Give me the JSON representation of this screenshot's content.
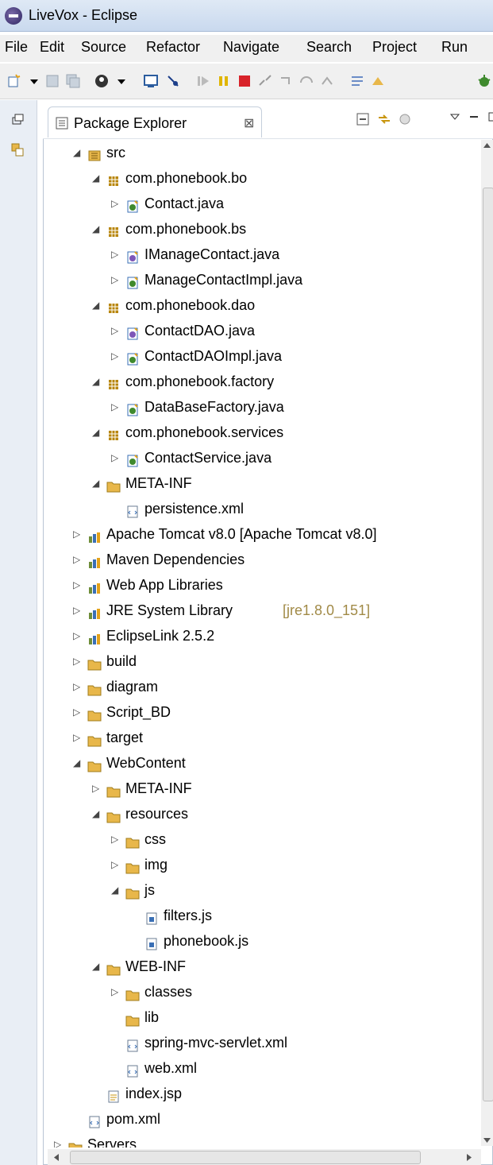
{
  "window": {
    "title": "LiveVox - Eclipse"
  },
  "menu": [
    "File",
    "Edit",
    "Source",
    "Refactor",
    "Navigate",
    "Search",
    "Project",
    "Run"
  ],
  "panel": {
    "title": "Package Explorer",
    "close_glyph": "⊠"
  },
  "tree": [
    {
      "label": "src",
      "depth": 0,
      "state": "open",
      "icon": "package-root-icon"
    },
    {
      "label": "com.phonebook.bo",
      "depth": 1,
      "state": "open",
      "icon": "package-icon"
    },
    {
      "label": "Contact.java",
      "depth": 2,
      "state": "closed",
      "icon": "java-class-icon"
    },
    {
      "label": "com.phonebook.bs",
      "depth": 1,
      "state": "open",
      "icon": "package-icon"
    },
    {
      "label": "IManageContact.java",
      "depth": 2,
      "state": "closed",
      "icon": "java-interface-icon"
    },
    {
      "label": "ManageContactImpl.java",
      "depth": 2,
      "state": "closed",
      "icon": "java-class-icon"
    },
    {
      "label": "com.phonebook.dao",
      "depth": 1,
      "state": "open",
      "icon": "package-icon"
    },
    {
      "label": "ContactDAO.java",
      "depth": 2,
      "state": "closed",
      "icon": "java-interface-icon"
    },
    {
      "label": "ContactDAOImpl.java",
      "depth": 2,
      "state": "closed",
      "icon": "java-class-icon"
    },
    {
      "label": "com.phonebook.factory",
      "depth": 1,
      "state": "open",
      "icon": "package-icon"
    },
    {
      "label": "DataBaseFactory.java",
      "depth": 2,
      "state": "closed",
      "icon": "java-class-icon"
    },
    {
      "label": "com.phonebook.services",
      "depth": 1,
      "state": "open",
      "icon": "package-icon"
    },
    {
      "label": "ContactService.java",
      "depth": 2,
      "state": "closed",
      "icon": "java-class-icon"
    },
    {
      "label": "META-INF",
      "depth": 1,
      "state": "open",
      "icon": "folder-icon"
    },
    {
      "label": "persistence.xml",
      "depth": 2,
      "state": "none",
      "icon": "xml-file-icon"
    },
    {
      "label": "Apache Tomcat v8.0 [Apache Tomcat v8.0]",
      "depth": 0,
      "state": "closed",
      "icon": "library-icon"
    },
    {
      "label": "Maven Dependencies",
      "depth": 0,
      "state": "closed",
      "icon": "library-icon"
    },
    {
      "label": "Web App Libraries",
      "depth": 0,
      "state": "closed",
      "icon": "library-icon"
    },
    {
      "label": "JRE System Library",
      "extra": "[jre1.8.0_151]",
      "depth": 0,
      "state": "closed",
      "icon": "library-icon"
    },
    {
      "label": "EclipseLink 2.5.2",
      "depth": 0,
      "state": "closed",
      "icon": "library-icon"
    },
    {
      "label": "build",
      "depth": 0,
      "state": "closed",
      "icon": "folder-icon"
    },
    {
      "label": "diagram",
      "depth": 0,
      "state": "closed",
      "icon": "folder-icon"
    },
    {
      "label": "Script_BD",
      "depth": 0,
      "state": "closed",
      "icon": "folder-icon"
    },
    {
      "label": "target",
      "depth": 0,
      "state": "closed",
      "icon": "folder-icon"
    },
    {
      "label": "WebContent",
      "depth": 0,
      "state": "open",
      "icon": "folder-icon"
    },
    {
      "label": "META-INF",
      "depth": 1,
      "state": "closed",
      "icon": "folder-icon"
    },
    {
      "label": "resources",
      "depth": 1,
      "state": "open",
      "icon": "folder-icon"
    },
    {
      "label": "css",
      "depth": 2,
      "state": "closed",
      "icon": "folder-icon"
    },
    {
      "label": "img",
      "depth": 2,
      "state": "closed",
      "icon": "folder-icon"
    },
    {
      "label": "js",
      "depth": 2,
      "state": "open",
      "icon": "folder-icon"
    },
    {
      "label": "filters.js",
      "depth": 3,
      "state": "none",
      "icon": "js-file-icon"
    },
    {
      "label": "phonebook.js",
      "depth": 3,
      "state": "none",
      "icon": "js-file-icon"
    },
    {
      "label": "WEB-INF",
      "depth": 1,
      "state": "open",
      "icon": "folder-icon"
    },
    {
      "label": "classes",
      "depth": 2,
      "state": "closed",
      "icon": "folder-icon"
    },
    {
      "label": "lib",
      "depth": 2,
      "state": "none",
      "icon": "folder-icon"
    },
    {
      "label": "spring-mvc-servlet.xml",
      "depth": 2,
      "state": "none",
      "icon": "xml-file-icon"
    },
    {
      "label": "web.xml",
      "depth": 2,
      "state": "none",
      "icon": "xml-file-icon"
    },
    {
      "label": "index.jsp",
      "depth": 1,
      "state": "none",
      "icon": "jsp-file-icon"
    },
    {
      "label": "pom.xml",
      "depth": 0,
      "state": "none",
      "icon": "xml-file-icon"
    },
    {
      "label": "Servers",
      "depth": -1,
      "state": "closed",
      "icon": "folder-icon"
    }
  ],
  "colors": {
    "folder": "#e8b74a",
    "package": "#b8860b",
    "java": "#3a6fb5",
    "library": "#6f8e3a"
  }
}
